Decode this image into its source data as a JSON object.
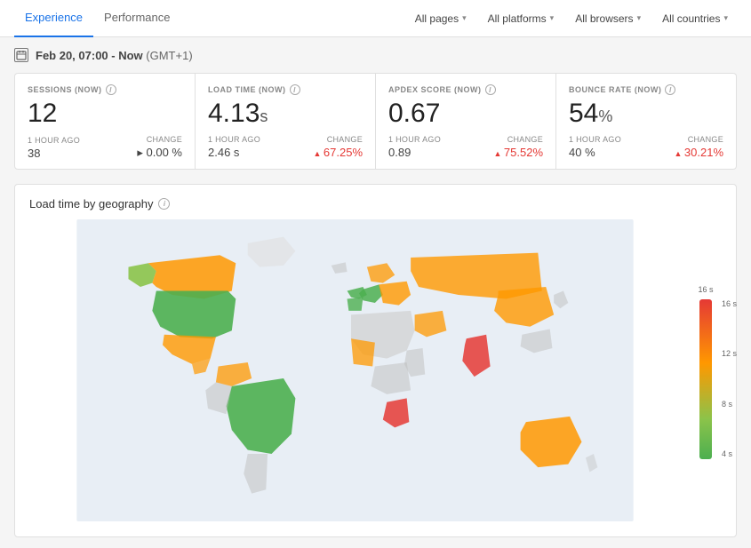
{
  "nav": {
    "tabs": [
      {
        "label": "Experience",
        "active": true
      },
      {
        "label": "Performance",
        "active": false
      }
    ],
    "filters": [
      {
        "label": "All pages",
        "id": "pages"
      },
      {
        "label": "All platforms",
        "id": "platforms"
      },
      {
        "label": "All browsers",
        "id": "browsers"
      },
      {
        "label": "All countries",
        "id": "countries"
      }
    ]
  },
  "date": {
    "icon": "📅",
    "text": "Feb 20, 07:00 - Now",
    "timezone": "(GMT+1)"
  },
  "metrics": [
    {
      "id": "sessions",
      "label": "SESSIONS (NOW)",
      "value": "12",
      "unit": "",
      "ago_label": "1 HOUR AGO",
      "prev_value": "38",
      "change_label": "CHANGE",
      "change_value": "0.00 %",
      "change_type": "neutral"
    },
    {
      "id": "load-time",
      "label": "LOAD TIME (NOW)",
      "value": "4.13",
      "unit": "s",
      "ago_label": "1 HOUR AGO",
      "prev_value": "2.46 s",
      "change_label": "CHANGE",
      "change_value": "67.25%",
      "change_type": "up-bad"
    },
    {
      "id": "apdex",
      "label": "APDEX SCORE (NOW)",
      "value": "0.67",
      "unit": "",
      "ago_label": "1 HOUR AGO",
      "prev_value": "0.89",
      "change_label": "CHANGE",
      "change_value": "75.52%",
      "change_type": "up-bad"
    },
    {
      "id": "bounce-rate",
      "label": "BOUNCE RATE (NOW)",
      "value": "54",
      "unit": "%",
      "ago_label": "1 HOUR AGO",
      "prev_value": "40 %",
      "change_label": "CHANGE",
      "change_value": "30.21%",
      "change_type": "up-bad"
    }
  ],
  "map": {
    "title": "Load time by geography",
    "legend_values": [
      "16 s",
      "12 s",
      "8 s",
      "4 s"
    ]
  }
}
